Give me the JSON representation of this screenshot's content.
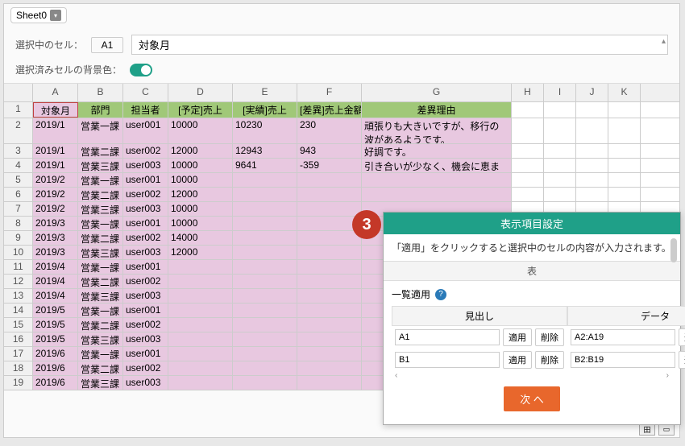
{
  "tab": {
    "name": "Sheet0"
  },
  "controls": {
    "selected_label": "選択中のセル：",
    "cell_ref": "A1",
    "cell_content": "対象月",
    "bg_label": "選択済みセルの背景色："
  },
  "columns": [
    "A",
    "B",
    "C",
    "D",
    "E",
    "F",
    "G",
    "H",
    "I",
    "J",
    "K"
  ],
  "colWidths": [
    "wA",
    "wB",
    "wC",
    "wD",
    "wE",
    "wF",
    "wG",
    "wH",
    "wI",
    "wJ",
    "wK"
  ],
  "headers": [
    "対象月",
    "部門",
    "担当者",
    "[予定]売上",
    "[実績]売上",
    "[差異]売上金額",
    "差異理由"
  ],
  "rows": [
    [
      "2019/1",
      "営業一課",
      "user001",
      "10000",
      "10230",
      "230",
      "頑張りも大きいですが、移行の波があるようです。"
    ],
    [
      "2019/1",
      "営業二課",
      "user002",
      "12000",
      "12943",
      "943",
      "好調です。"
    ],
    [
      "2019/1",
      "営業三課",
      "user003",
      "10000",
      "9641",
      "-359",
      "引き合いが少なく、機会に恵まれません"
    ],
    [
      "2019/2",
      "営業一課",
      "user001",
      "10000",
      "",
      "",
      ""
    ],
    [
      "2019/2",
      "営業二課",
      "user002",
      "12000",
      "",
      "",
      ""
    ],
    [
      "2019/2",
      "営業三課",
      "user003",
      "10000",
      "",
      "",
      ""
    ],
    [
      "2019/3",
      "営業一課",
      "user001",
      "10000",
      "",
      "",
      ""
    ],
    [
      "2019/3",
      "営業二課",
      "user002",
      "14000",
      "",
      "",
      ""
    ],
    [
      "2019/3",
      "営業三課",
      "user003",
      "12000",
      "",
      "",
      ""
    ],
    [
      "2019/4",
      "営業一課",
      "user001",
      "",
      "",
      "",
      ""
    ],
    [
      "2019/4",
      "営業二課",
      "user002",
      "",
      "",
      "",
      ""
    ],
    [
      "2019/4",
      "営業三課",
      "user003",
      "",
      "",
      "",
      ""
    ],
    [
      "2019/5",
      "営業一課",
      "user001",
      "",
      "",
      "",
      ""
    ],
    [
      "2019/5",
      "営業二課",
      "user002",
      "",
      "",
      "",
      ""
    ],
    [
      "2019/5",
      "営業三課",
      "user003",
      "",
      "",
      "",
      ""
    ],
    [
      "2019/6",
      "営業一課",
      "user001",
      "",
      "",
      "",
      ""
    ],
    [
      "2019/6",
      "営業二課",
      "user002",
      "",
      "",
      "",
      ""
    ],
    [
      "2019/6",
      "営業三課",
      "user003",
      "",
      "",
      "",
      ""
    ]
  ],
  "callout": "3",
  "dialog": {
    "title": "表示項目設定",
    "hint": "「適用」をクリックすると選択中のセルの内容が入力されます。",
    "section": "表",
    "batch": "一覧適用",
    "col_headings_label": "見出し",
    "col_data_label": "データ",
    "apply": "適用",
    "delete": "削除",
    "rows": [
      {
        "h": "A1",
        "d": "A2:A19"
      },
      {
        "h": "B1",
        "d": "B2:B19"
      }
    ],
    "next": "次 へ"
  }
}
